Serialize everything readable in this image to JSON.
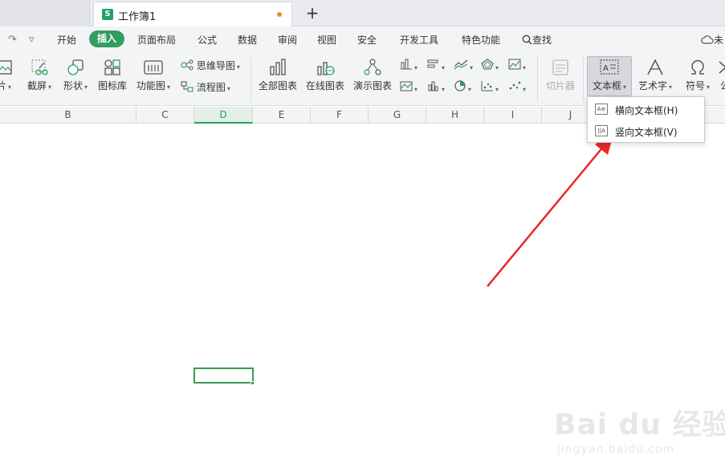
{
  "tabs": {
    "doc_title": "工作簿1",
    "doc_icon_letter": "S",
    "new_tab": "+"
  },
  "menu": {
    "undo": "↶",
    "redo": "↷",
    "more": "▿",
    "items": [
      "开始",
      "插入",
      "页面布局",
      "公式",
      "数据",
      "审阅",
      "视图",
      "安全",
      "开发工具",
      "特色功能"
    ],
    "search_label": "查找",
    "cloud_label": "未"
  },
  "ribbon": {
    "picture_label": "片",
    "screenshot_label": "截屏",
    "shape_label": "形状",
    "iconlib_label": "图标库",
    "function_chart_label": "功能图",
    "mindmap_label": "思维导图",
    "flowchart_label": "流程图",
    "all_charts_label": "全部图表",
    "online_charts_label": "在线图表",
    "demo_charts_label": "演示图表",
    "slicer_label": "切片器",
    "textbox_label": "文本框",
    "wordart_label": "艺术字",
    "symbol_label": "符号",
    "formula_label": "公"
  },
  "columns": [
    "B",
    "C",
    "D",
    "E",
    "F",
    "G",
    "H",
    "I",
    "J"
  ],
  "active_column": "D",
  "textbox_menu": {
    "items": [
      {
        "label": "横向文本框(H)",
        "icon": "horizontal-textbox-icon"
      },
      {
        "label": "竖向文本框(V)",
        "icon": "vertical-textbox-icon"
      }
    ]
  },
  "annotation": {
    "arrow_color": "#e8262a"
  },
  "watermark": {
    "logo": "Bai du 经验",
    "url": "jingyan.baidu.com"
  },
  "colors": {
    "accent": "#2f9e5f",
    "selection": "#3a9c4e"
  }
}
